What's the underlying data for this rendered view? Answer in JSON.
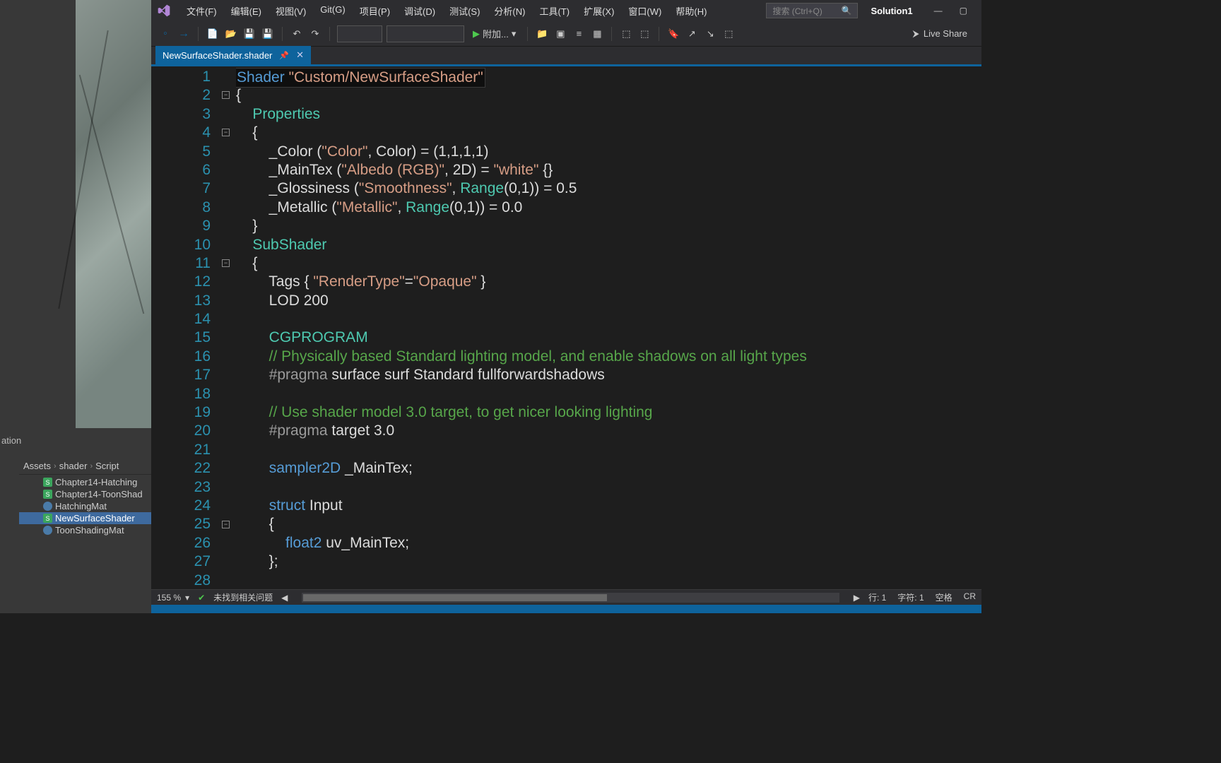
{
  "unity": {
    "label_ation": "ation",
    "breadcrumb": [
      "Assets",
      "shader",
      "Script"
    ],
    "assets": [
      {
        "name": "Chapter14-Hatching",
        "type": "shader"
      },
      {
        "name": "Chapter14-ToonShad",
        "type": "shader"
      },
      {
        "name": "HatchingMat",
        "type": "mat"
      },
      {
        "name": "NewSurfaceShader",
        "type": "shader",
        "selected": true
      },
      {
        "name": "ToonShadingMat",
        "type": "mat"
      }
    ]
  },
  "vs": {
    "menus": [
      "文件(F)",
      "编辑(E)",
      "视图(V)",
      "Git(G)",
      "项目(P)",
      "调试(D)",
      "测试(S)",
      "分析(N)",
      "工具(T)",
      "扩展(X)",
      "窗口(W)",
      "帮助(H)"
    ],
    "search_placeholder": "搜索 (Ctrl+Q)",
    "solution": "Solution1",
    "start_label": "附加...",
    "live_share": "Live Share",
    "tab_name": "NewSurfaceShader.shader",
    "status": {
      "zoom": "155 %",
      "issues": "未找到相关问题",
      "line": "行: 1",
      "char": "字符: 1",
      "spaces": "空格",
      "crlf": "CR"
    },
    "code_lines": [
      [
        {
          "t": "Shader ",
          "c": "kw"
        },
        {
          "t": "\"Custom/NewSurfaceShader\"",
          "c": "str"
        }
      ],
      [
        {
          "t": "{",
          "c": "id"
        }
      ],
      [
        {
          "t": "    Properties",
          "c": "type"
        }
      ],
      [
        {
          "t": "    {",
          "c": "id"
        }
      ],
      [
        {
          "t": "        _Color (",
          "c": "id"
        },
        {
          "t": "\"Color\"",
          "c": "str"
        },
        {
          "t": ", Color) = (1,1,1,1)",
          "c": "id"
        }
      ],
      [
        {
          "t": "        _MainTex (",
          "c": "id"
        },
        {
          "t": "\"Albedo (RGB)\"",
          "c": "str"
        },
        {
          "t": ", 2D) = ",
          "c": "id"
        },
        {
          "t": "\"white\"",
          "c": "str"
        },
        {
          "t": " {}",
          "c": "id"
        }
      ],
      [
        {
          "t": "        _Glossiness (",
          "c": "id"
        },
        {
          "t": "\"Smoothness\"",
          "c": "str"
        },
        {
          "t": ", ",
          "c": "id"
        },
        {
          "t": "Range",
          "c": "type"
        },
        {
          "t": "(0,1)) = 0.5",
          "c": "id"
        }
      ],
      [
        {
          "t": "        _Metallic (",
          "c": "id"
        },
        {
          "t": "\"Metallic\"",
          "c": "str"
        },
        {
          "t": ", ",
          "c": "id"
        },
        {
          "t": "Range",
          "c": "type"
        },
        {
          "t": "(0,1)) = 0.0",
          "c": "id"
        }
      ],
      [
        {
          "t": "    }",
          "c": "id"
        }
      ],
      [
        {
          "t": "    SubShader",
          "c": "type"
        }
      ],
      [
        {
          "t": "    {",
          "c": "id"
        }
      ],
      [
        {
          "t": "        Tags { ",
          "c": "id"
        },
        {
          "t": "\"RenderType\"",
          "c": "str"
        },
        {
          "t": "=",
          "c": "id"
        },
        {
          "t": "\"Opaque\"",
          "c": "str"
        },
        {
          "t": " }",
          "c": "id"
        }
      ],
      [
        {
          "t": "        LOD 200",
          "c": "id"
        }
      ],
      [
        {
          "t": "",
          "c": "id"
        }
      ],
      [
        {
          "t": "        CGPROGRAM",
          "c": "type"
        }
      ],
      [
        {
          "t": "        // Physically based Standard lighting model, and enable shadows on all light types",
          "c": "com"
        }
      ],
      [
        {
          "t": "        ",
          "c": "id"
        },
        {
          "t": "#pragma",
          "c": "pre"
        },
        {
          "t": " surface surf Standard fullforwardshadows",
          "c": "id"
        }
      ],
      [
        {
          "t": "",
          "c": "id"
        }
      ],
      [
        {
          "t": "        // Use shader model 3.0 target, to get nicer looking lighting",
          "c": "com"
        }
      ],
      [
        {
          "t": "        ",
          "c": "id"
        },
        {
          "t": "#pragma",
          "c": "pre"
        },
        {
          "t": " target 3.0",
          "c": "id"
        }
      ],
      [
        {
          "t": "",
          "c": "id"
        }
      ],
      [
        {
          "t": "        ",
          "c": "id"
        },
        {
          "t": "sampler2D",
          "c": "kw"
        },
        {
          "t": " _MainTex;",
          "c": "id"
        }
      ],
      [
        {
          "t": "",
          "c": "id"
        }
      ],
      [
        {
          "t": "        ",
          "c": "id"
        },
        {
          "t": "struct",
          "c": "kw"
        },
        {
          "t": " Input",
          "c": "id"
        }
      ],
      [
        {
          "t": "        {",
          "c": "id"
        }
      ],
      [
        {
          "t": "            ",
          "c": "id"
        },
        {
          "t": "float2",
          "c": "kw"
        },
        {
          "t": " uv_MainTex;",
          "c": "id"
        }
      ],
      [
        {
          "t": "        };",
          "c": "id"
        }
      ],
      [
        {
          "t": "",
          "c": "id"
        }
      ]
    ],
    "fold_markers": [
      2,
      4,
      11,
      25
    ]
  }
}
